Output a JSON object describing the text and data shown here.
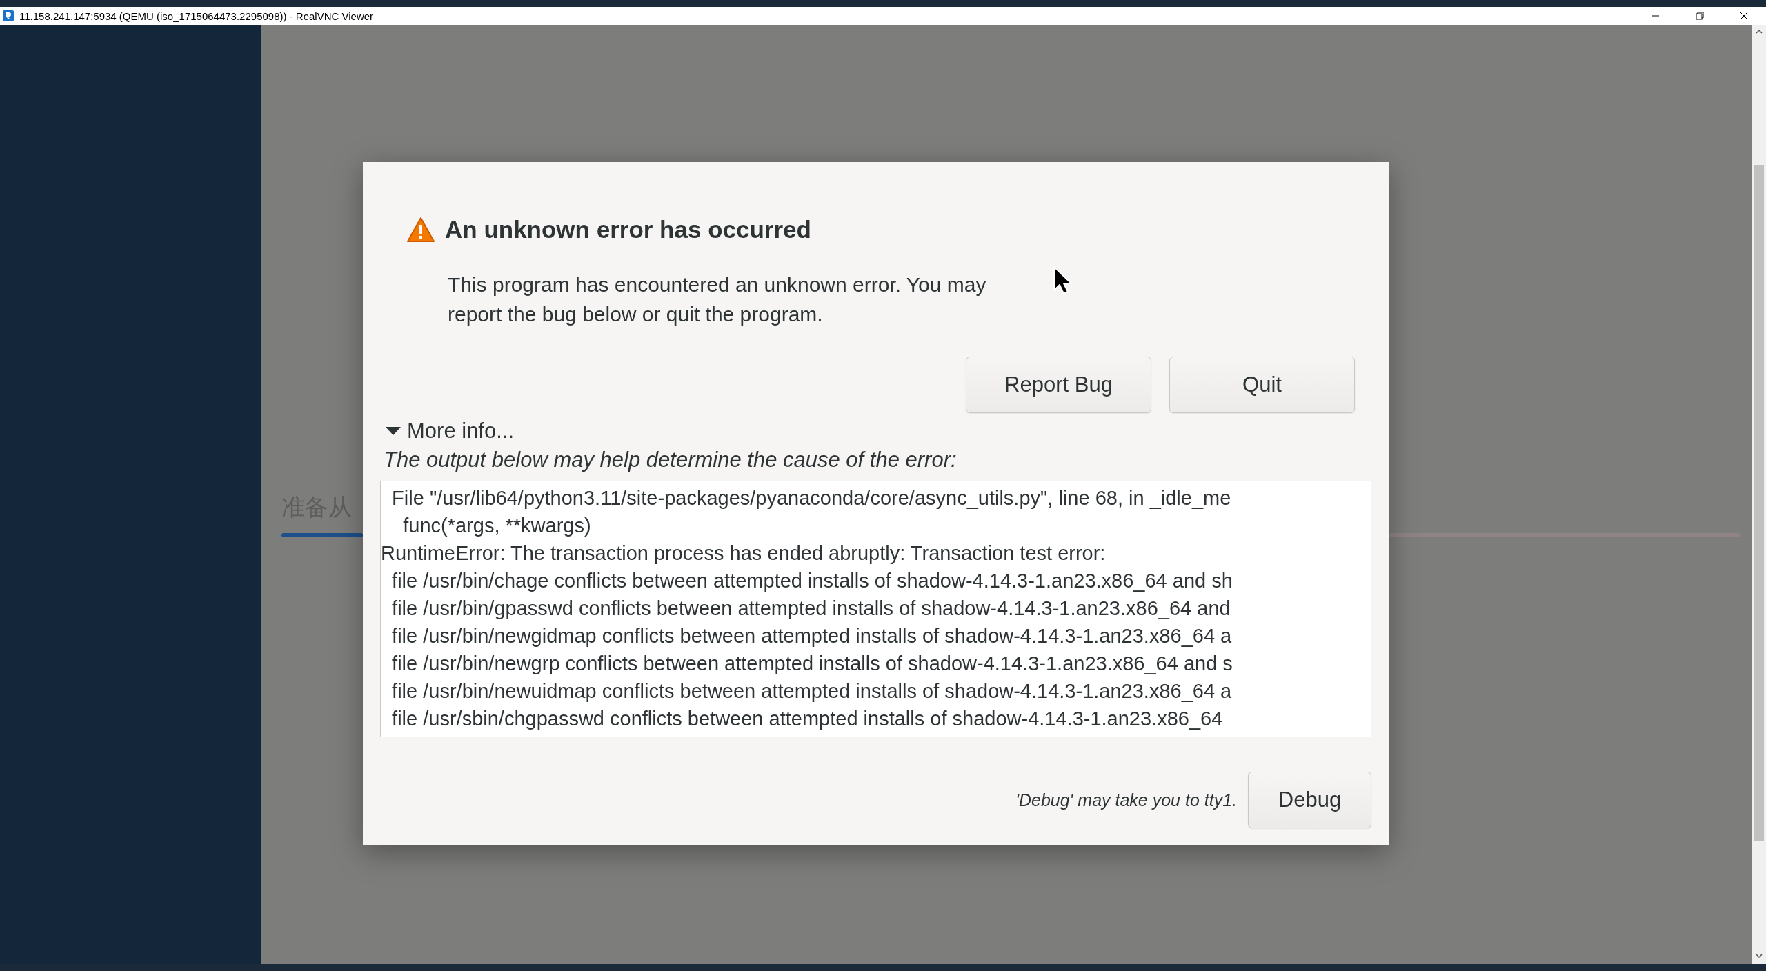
{
  "window": {
    "title": "11.158.241.147:5934 (QEMU (iso_1715064473.2295098)) - RealVNC Viewer"
  },
  "background": {
    "label": "准备从"
  },
  "dialog": {
    "title": "An unknown error has occurred",
    "message": "This program has encountered an unknown error. You may report the bug below or quit the program.",
    "buttons": [
      "Report Bug",
      "Quit"
    ],
    "more_info": {
      "label": "More info...",
      "expanded": true
    },
    "hint": "The output below may help determine the cause of the error:",
    "output_lines": [
      "  File \"/usr/lib64/python3.11/site-packages/pyanaconda/core/async_utils.py\", line 68, in _idle_me",
      "    func(*args, **kwargs)",
      "RuntimeError: The transaction process has ended abruptly: Transaction test error:",
      "  file /usr/bin/chage conflicts between attempted installs of shadow-4.14.3-1.an23.x86_64 and sh",
      "  file /usr/bin/gpasswd conflicts between attempted installs of shadow-4.14.3-1.an23.x86_64 and",
      "  file /usr/bin/newgidmap conflicts between attempted installs of shadow-4.14.3-1.an23.x86_64 a",
      "  file /usr/bin/newgrp conflicts between attempted installs of shadow-4.14.3-1.an23.x86_64 and s",
      "  file /usr/bin/newuidmap conflicts between attempted installs of shadow-4.14.3-1.an23.x86_64 a",
      "  file /usr/sbin/chgpasswd conflicts between attempted installs of shadow-4.14.3-1.an23.x86_64"
    ],
    "debug_hint": "'Debug' may take you to tty1.",
    "debug_button": "Debug"
  }
}
